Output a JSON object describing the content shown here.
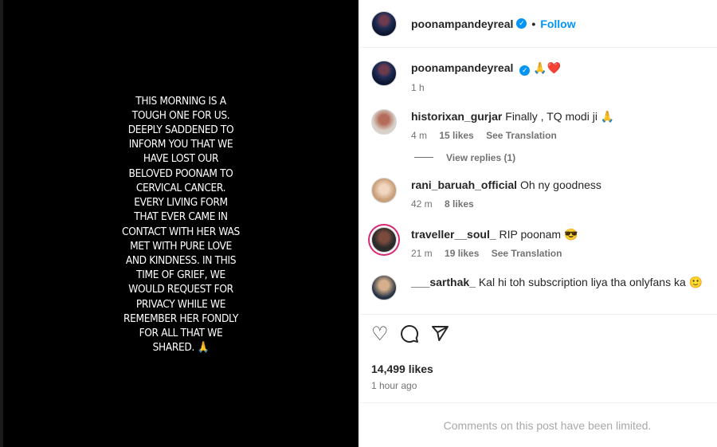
{
  "story": {
    "text": "THIS MORNING IS A\nTOUGH ONE FOR US.\nDEEPLY SADDENED TO\nINFORM YOU THAT WE\nHAVE LOST OUR\nBELOVED POONAM TO\nCERVICAL CANCER.\nEVERY LIVING FORM\nTHAT EVER CAME IN\nCONTACT WITH HER WAS\nMET WITH PURE LOVE\nAND KINDNESS. IN THIS\nTIME OF GRIEF, WE\nWOULD REQUEST FOR\nPRIVACY WHILE WE\nREMEMBER HER FONDLY\nFOR ALL THAT WE\nSHARED. 🙏"
  },
  "header": {
    "username": "poonampandeyreal",
    "verified_icon": "verified-badge-icon",
    "separator": "•",
    "follow_label": "Follow"
  },
  "caption": {
    "username": "poonampandeyreal",
    "text": "🙏❤️",
    "time": "1 h"
  },
  "comments": [
    {
      "username": "historixan_gurjar",
      "text": "Finally , TQ modi ji 🙏",
      "time": "4 m",
      "likes": "15 likes",
      "translate": "See Translation"
    },
    {
      "username": "rani_baruah_official",
      "text": "Oh ny goodness",
      "time": "42 m",
      "likes": "8 likes"
    },
    {
      "username": "traveller__soul_",
      "text": "RIP poonam 😎",
      "time": "21 m",
      "likes": "19 likes",
      "translate": "See Translation"
    },
    {
      "username": "___sarthak_",
      "text": "Kal hi toh subscription liya tha onlyfans ka 🙂"
    }
  ],
  "view_replies": "View replies (1)",
  "actions": {
    "like_icon": "heart-icon",
    "comment_icon": "comment-icon",
    "share_icon": "share-icon"
  },
  "likes_count": "14,499 likes",
  "posted": "1 hour ago",
  "limited_notice": "Comments on this post have been limited.",
  "colors": {
    "accent": "#0095f6",
    "secondary_text": "#737373",
    "like_red": "#ed4956"
  }
}
